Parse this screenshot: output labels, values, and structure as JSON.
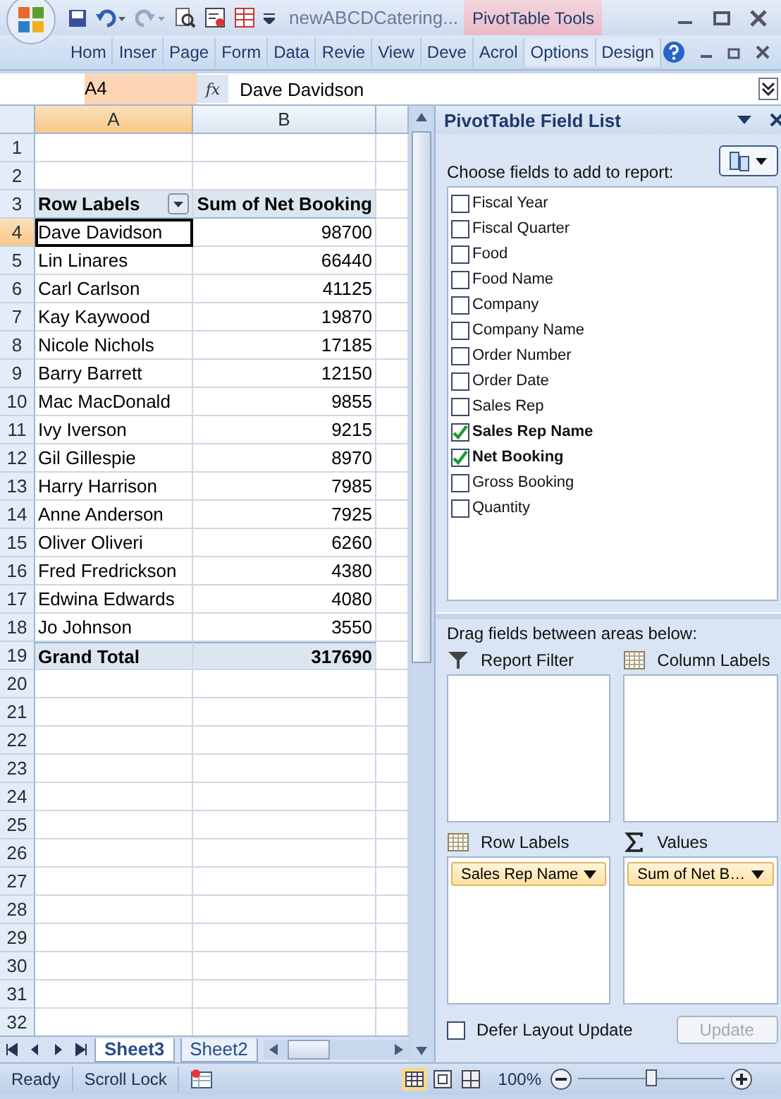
{
  "window": {
    "title": "newABCDCatering...",
    "context_tab": "PivotTable Tools"
  },
  "ribbon_tabs": [
    {
      "label": "Hom",
      "selected": false
    },
    {
      "label": "Inser",
      "selected": false
    },
    {
      "label": "Page",
      "selected": false
    },
    {
      "label": "Form",
      "selected": false
    },
    {
      "label": "Data",
      "selected": false
    },
    {
      "label": "Revie",
      "selected": false
    },
    {
      "label": "View",
      "selected": false
    },
    {
      "label": "Deve",
      "selected": false
    },
    {
      "label": "Acrol",
      "selected": false
    },
    {
      "label": "Options",
      "selected": false
    },
    {
      "label": "Design",
      "selected": false
    }
  ],
  "formula_bar": {
    "name_box": "A4",
    "fx": "fx",
    "value": "Dave Davidson"
  },
  "sheet": {
    "columns": [
      {
        "label": "A",
        "selected": true
      },
      {
        "label": "B",
        "selected": false
      }
    ],
    "rows": [
      {
        "number": "1",
        "selected": false
      },
      {
        "number": "2",
        "selected": false
      },
      {
        "number": "3",
        "selected": false,
        "kind": "header",
        "cells": [
          "Row Labels",
          "Sum of Net Booking"
        ]
      },
      {
        "number": "4",
        "selected": true,
        "kind": "data",
        "cells": [
          "Dave Davidson",
          "98700"
        ]
      },
      {
        "number": "5",
        "selected": false,
        "kind": "data",
        "cells": [
          "Lin Linares",
          "66440"
        ]
      },
      {
        "number": "6",
        "selected": false,
        "kind": "data",
        "cells": [
          "Carl Carlson",
          "41125"
        ]
      },
      {
        "number": "7",
        "selected": false,
        "kind": "data",
        "cells": [
          "Kay Kaywood",
          "19870"
        ]
      },
      {
        "number": "8",
        "selected": false,
        "kind": "data",
        "cells": [
          "Nicole Nichols",
          "17185"
        ]
      },
      {
        "number": "9",
        "selected": false,
        "kind": "data",
        "cells": [
          "Barry Barrett",
          "12150"
        ]
      },
      {
        "number": "10",
        "selected": false,
        "kind": "data",
        "cells": [
          "Mac MacDonald",
          "9855"
        ]
      },
      {
        "number": "11",
        "selected": false,
        "kind": "data",
        "cells": [
          "Ivy Iverson",
          "9215"
        ]
      },
      {
        "number": "12",
        "selected": false,
        "kind": "data",
        "cells": [
          "Gil Gillespie",
          "8970"
        ]
      },
      {
        "number": "13",
        "selected": false,
        "kind": "data",
        "cells": [
          "Harry Harrison",
          "7985"
        ]
      },
      {
        "number": "14",
        "selected": false,
        "kind": "data",
        "cells": [
          "Anne Anderson",
          "7925"
        ]
      },
      {
        "number": "15",
        "selected": false,
        "kind": "data",
        "cells": [
          "Oliver Oliveri",
          "6260"
        ]
      },
      {
        "number": "16",
        "selected": false,
        "kind": "data",
        "cells": [
          "Fred Fredrickson",
          "4380"
        ]
      },
      {
        "number": "17",
        "selected": false,
        "kind": "data",
        "cells": [
          "Edwina Edwards",
          "4080"
        ]
      },
      {
        "number": "18",
        "selected": false,
        "kind": "data",
        "cells": [
          "Jo Johnson",
          "3550"
        ]
      },
      {
        "number": "19",
        "selected": false,
        "kind": "total",
        "cells": [
          "Grand Total",
          "317690"
        ]
      },
      {
        "number": "20",
        "selected": false
      },
      {
        "number": "21",
        "selected": false
      },
      {
        "number": "22",
        "selected": false
      },
      {
        "number": "23",
        "selected": false
      },
      {
        "number": "24",
        "selected": false
      },
      {
        "number": "25",
        "selected": false
      },
      {
        "number": "26",
        "selected": false
      },
      {
        "number": "27",
        "selected": false
      },
      {
        "number": "28",
        "selected": false
      },
      {
        "number": "29",
        "selected": false
      },
      {
        "number": "30",
        "selected": false
      },
      {
        "number": "31",
        "selected": false
      },
      {
        "number": "32",
        "selected": false
      }
    ],
    "sheet_tabs": [
      {
        "label": "Sheet3",
        "selected": true
      },
      {
        "label": "Sheet2",
        "selected": false
      }
    ]
  },
  "field_list": {
    "title": "PivotTable Field List",
    "prompt": "Choose fields to add to report:",
    "fields": [
      {
        "label": "Fiscal Year",
        "checked": false
      },
      {
        "label": "Fiscal Quarter",
        "checked": false
      },
      {
        "label": "Food",
        "checked": false
      },
      {
        "label": "Food Name",
        "checked": false
      },
      {
        "label": "Company",
        "checked": false
      },
      {
        "label": "Company Name",
        "checked": false
      },
      {
        "label": "Order Number",
        "checked": false
      },
      {
        "label": "Order Date",
        "checked": false
      },
      {
        "label": "Sales Rep",
        "checked": false
      },
      {
        "label": "Sales Rep Name",
        "checked": true
      },
      {
        "label": "Net Booking",
        "checked": true
      },
      {
        "label": "Gross Booking",
        "checked": false
      },
      {
        "label": "Quantity",
        "checked": false
      }
    ],
    "areas_prompt": "Drag fields between areas below:",
    "areas": [
      {
        "kind": "filter",
        "label": "Report Filter"
      },
      {
        "kind": "columns",
        "label": "Column Labels"
      },
      {
        "kind": "rows",
        "label": "Row Labels",
        "items": [
          "Sales Rep Name"
        ]
      },
      {
        "kind": "values",
        "label": "Values",
        "items": [
          "Sum of Net B…"
        ]
      }
    ],
    "defer_update": {
      "label": "Defer Layout Update",
      "checked": false
    },
    "update_button": {
      "label": "Update",
      "disabled": true
    }
  },
  "status_bar": {
    "mode": "Ready",
    "scroll_lock": "Scroll Lock",
    "zoom": "100%",
    "zoom_slider": {
      "level": 0.5
    }
  }
}
